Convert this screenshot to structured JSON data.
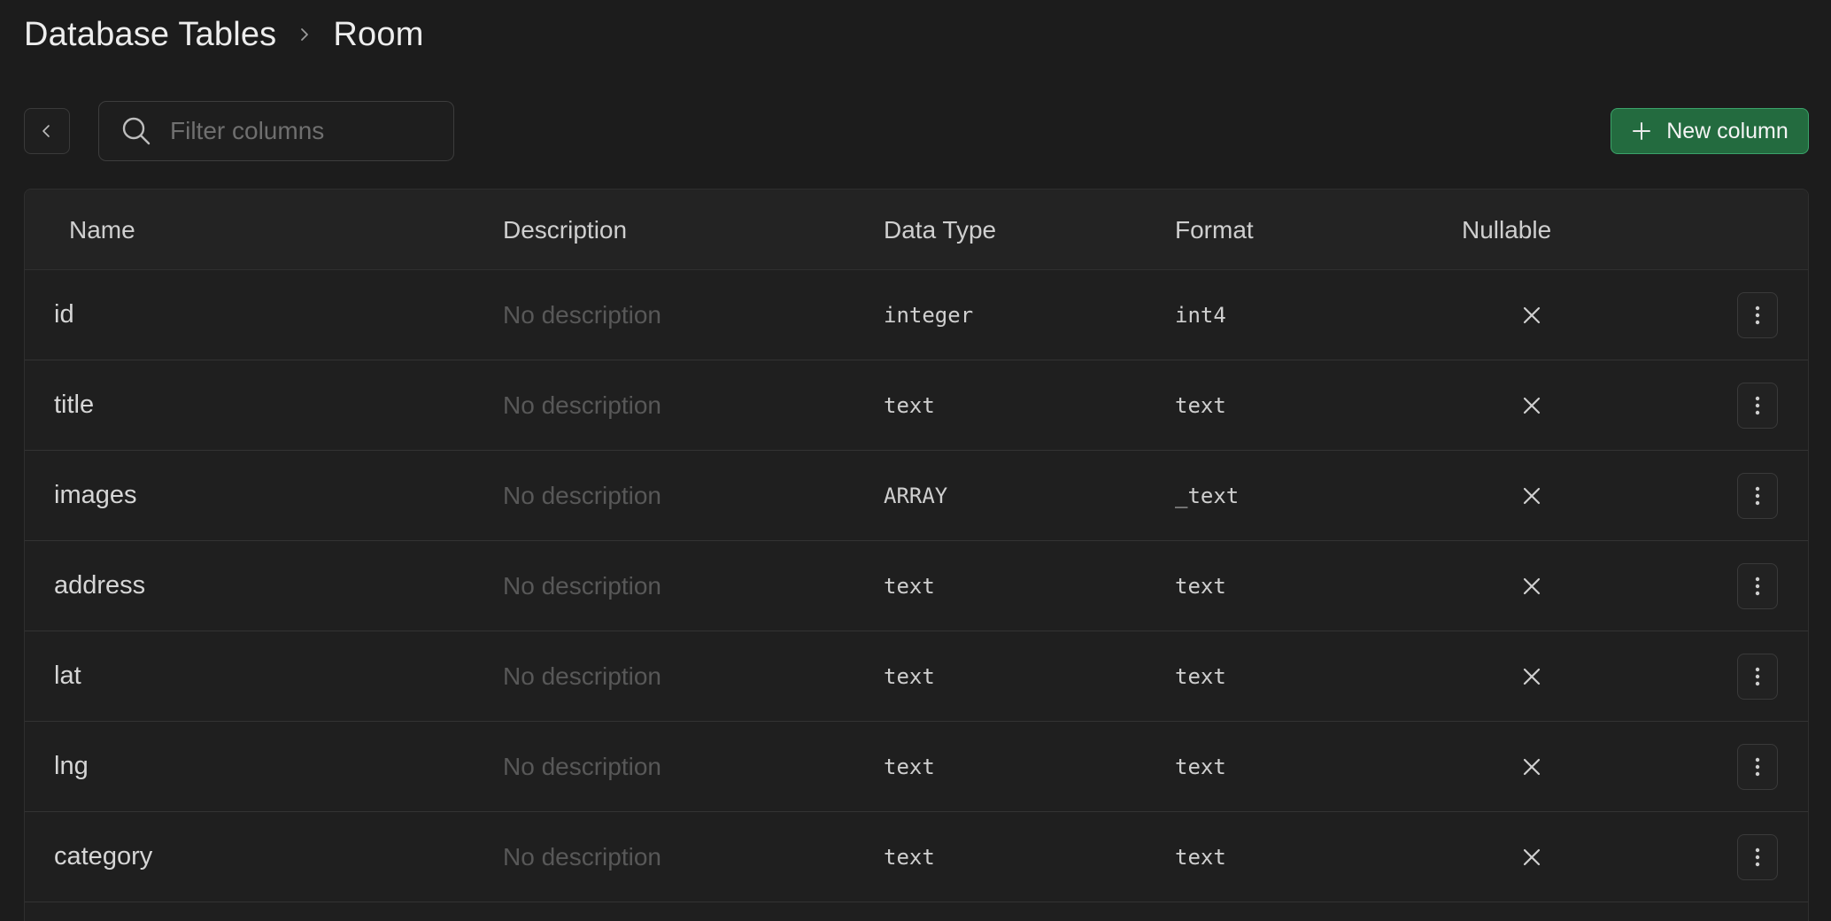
{
  "breadcrumb": {
    "root": "Database Tables",
    "current": "Room"
  },
  "toolbar": {
    "filter_placeholder": "Filter columns",
    "filter_value": "",
    "new_column_label": "New column"
  },
  "colors": {
    "background": "#1c1c1c",
    "primary_button": "#236b3f",
    "primary_button_border": "#3ba36a"
  },
  "table": {
    "headers": {
      "name": "Name",
      "description": "Description",
      "data_type": "Data Type",
      "format": "Format",
      "nullable": "Nullable"
    },
    "rows": [
      {
        "name": "id",
        "description": "No description",
        "data_type": "integer",
        "format": "int4",
        "nullable": false
      },
      {
        "name": "title",
        "description": "No description",
        "data_type": "text",
        "format": "text",
        "nullable": false
      },
      {
        "name": "images",
        "description": "No description",
        "data_type": "ARRAY",
        "format": "_text",
        "nullable": false
      },
      {
        "name": "address",
        "description": "No description",
        "data_type": "text",
        "format": "text",
        "nullable": false
      },
      {
        "name": "lat",
        "description": "No description",
        "data_type": "text",
        "format": "text",
        "nullable": false
      },
      {
        "name": "lng",
        "description": "No description",
        "data_type": "text",
        "format": "text",
        "nullable": false
      },
      {
        "name": "category",
        "description": "No description",
        "data_type": "text",
        "format": "text",
        "nullable": false
      }
    ]
  },
  "icons": {
    "breadcrumb_separator": "chevron-right-icon",
    "back": "chevron-left-icon",
    "search": "search-icon",
    "add": "plus-icon",
    "not_nullable": "x-icon",
    "row_menu": "more-vertical-icon"
  }
}
